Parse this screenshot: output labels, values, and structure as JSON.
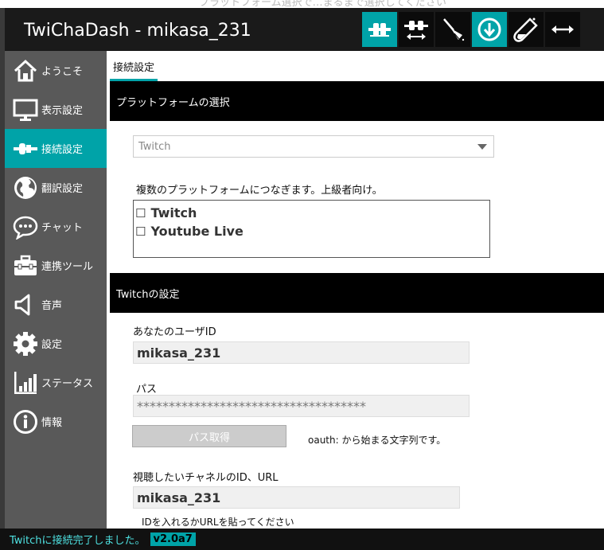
{
  "window": {
    "title": "TwiChaDash - mikasa_231",
    "top_clipped_text": "プラットフォーム選択で…まるまで選択してください"
  },
  "toolbar": {
    "buttons": [
      {
        "name": "connect",
        "icon": "plug-connected-icon",
        "active": true
      },
      {
        "name": "disconnect",
        "icon": "plug-disconnected-icon",
        "active": false
      },
      {
        "name": "clear",
        "icon": "broom-icon",
        "active": false
      },
      {
        "name": "download",
        "icon": "download-icon",
        "active": true
      },
      {
        "name": "test",
        "icon": "test-tube-icon",
        "active": false
      },
      {
        "name": "resize",
        "icon": "horizontal-resize-icon",
        "active": false
      }
    ]
  },
  "sidebar": {
    "items": [
      {
        "label": "ようこそ",
        "icon": "home-icon",
        "active": false
      },
      {
        "label": "表示設定",
        "icon": "monitor-icon",
        "active": false
      },
      {
        "label": "接続設定",
        "icon": "plug-icon",
        "active": true
      },
      {
        "label": "翻訳設定",
        "icon": "globe-icon",
        "active": false
      },
      {
        "label": "チャット",
        "icon": "chat-bubble-icon",
        "active": false
      },
      {
        "label": "連携ツール",
        "icon": "toolbox-icon",
        "active": false
      },
      {
        "label": "音声",
        "icon": "speaker-icon",
        "active": false
      },
      {
        "label": "設定",
        "icon": "gear-icon",
        "active": false
      },
      {
        "label": "ステータス",
        "icon": "bar-chart-icon",
        "active": false
      },
      {
        "label": "情報",
        "icon": "info-icon",
        "active": false
      }
    ]
  },
  "main": {
    "tab_label": "接続設定",
    "platform_section": {
      "header": "プラットフォームの選択",
      "select_value": "Twitch",
      "multi_note": "複数のプラットフォームにつなぎます。上級者向け。",
      "platforms": [
        {
          "label": "Twitch",
          "checked": false
        },
        {
          "label": "Youtube Live",
          "checked": false
        }
      ]
    },
    "twitch_section": {
      "header": "Twitchの設定",
      "user_id_label": "あなたのユーザID",
      "user_id_value": "mikasa_231",
      "pass_label": "パス",
      "pass_value": "************************************",
      "get_pass_button": "パス取得",
      "oauth_note": "oauth: から始まる文字列です。",
      "channel_label": "視聴したいチャネルのID、URL",
      "channel_value": "mikasa_231",
      "channel_note": "IDを入れるかURLを貼ってください"
    }
  },
  "status": {
    "text": "Twitchに接続完了しました。",
    "version": "v2.0a7"
  },
  "colors": {
    "accent": "#00a3a8",
    "sidebar": "#595959",
    "titlebar": "#1a1a1a",
    "section_header": "#000000"
  }
}
